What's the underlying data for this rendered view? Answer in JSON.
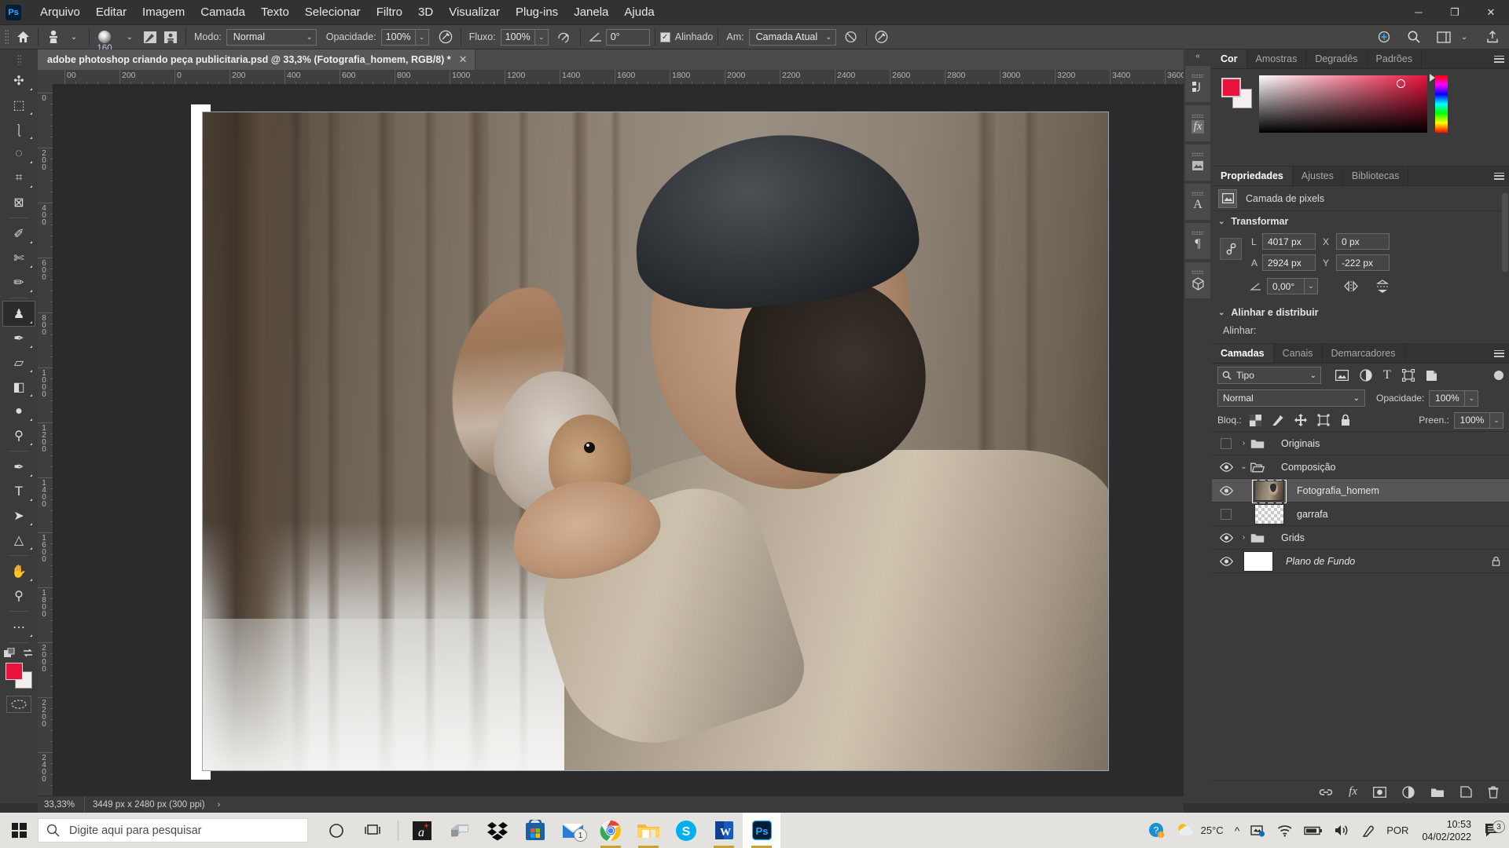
{
  "app": {
    "logo": "Ps",
    "menus": [
      "Arquivo",
      "Editar",
      "Imagem",
      "Camada",
      "Texto",
      "Selecionar",
      "Filtro",
      "3D",
      "Visualizar",
      "Plug-ins",
      "Janela",
      "Ajuda"
    ],
    "window_controls": {
      "minimize": "─",
      "maximize": "❐",
      "close": "✕"
    }
  },
  "options_bar": {
    "home_icon": "home-icon",
    "tool_preset_icon": "clone-stamp-icon",
    "brush_size": "160",
    "brush_panel_icon": "brush-settings-icon",
    "clone_source_icon": "clone-source-icon",
    "mode_label": "Modo:",
    "mode_value": "Normal",
    "opacity_label": "Opacidade:",
    "opacity_value": "100%",
    "pressure_opacity_icon": "pressure-opacity-icon",
    "flow_label": "Fluxo:",
    "flow_value": "100%",
    "airbrush_icon": "airbrush-icon",
    "angle_label_icon": "angle-icon",
    "angle_value": "0°",
    "aligned_label": "Alinhado",
    "aligned_checked": true,
    "sample_label": "Am:",
    "sample_value": "Camada Atual",
    "ignore_adjustment_icon": "ignore-adjustment-icon",
    "pressure_size_icon": "pressure-size-icon",
    "share_icon": "share-icon",
    "search_icon": "search-icon",
    "workspace_icon": "workspace-icon",
    "export_icon": "export-icon"
  },
  "document": {
    "tab_title": "adobe photoshop criando peça publicitaria.psd @ 33,3% (Fotografia_homem, RGB/8) *",
    "tab_close": "✕"
  },
  "toolbar": {
    "tools": [
      {
        "name": "move-tool",
        "glyph": "✣",
        "has_submenu": true,
        "active": false
      },
      {
        "name": "marquee-tool",
        "glyph": "⬚",
        "has_submenu": true,
        "active": false
      },
      {
        "name": "lasso-tool",
        "glyph": "⎱",
        "has_submenu": true,
        "active": false
      },
      {
        "name": "object-selection-tool",
        "glyph": "◌",
        "has_submenu": true,
        "active": false
      },
      {
        "name": "crop-tool",
        "glyph": "⌗",
        "has_submenu": true,
        "active": false
      },
      {
        "name": "frame-tool",
        "glyph": "⊠",
        "has_submenu": false,
        "active": false
      },
      {
        "name": "eyedropper-tool",
        "glyph": "✐",
        "has_submenu": true,
        "active": false
      },
      {
        "name": "spot-healing-brush-tool",
        "glyph": "✄",
        "has_submenu": true,
        "active": false
      },
      {
        "name": "brush-tool",
        "glyph": "✏",
        "has_submenu": true,
        "active": false
      },
      {
        "name": "clone-stamp-tool",
        "glyph": "♟",
        "has_submenu": true,
        "active": true
      },
      {
        "name": "history-brush-tool",
        "glyph": "✒",
        "has_submenu": true,
        "active": false
      },
      {
        "name": "eraser-tool",
        "glyph": "▱",
        "has_submenu": true,
        "active": false
      },
      {
        "name": "gradient-tool",
        "glyph": "◧",
        "has_submenu": true,
        "active": false
      },
      {
        "name": "blur-tool",
        "glyph": "●",
        "has_submenu": true,
        "active": false
      },
      {
        "name": "dodge-tool",
        "glyph": "⚲",
        "has_submenu": true,
        "active": false
      },
      {
        "name": "pen-tool",
        "glyph": "✒",
        "has_submenu": true,
        "active": false
      },
      {
        "name": "type-tool",
        "glyph": "T",
        "has_submenu": true,
        "active": false
      },
      {
        "name": "path-selection-tool",
        "glyph": "➤",
        "has_submenu": true,
        "active": false
      },
      {
        "name": "shape-tool",
        "glyph": "△",
        "has_submenu": true,
        "active": false
      },
      {
        "name": "hand-tool",
        "glyph": "✋",
        "has_submenu": true,
        "active": false
      },
      {
        "name": "zoom-tool",
        "glyph": "⚲",
        "has_submenu": false,
        "active": false
      },
      {
        "name": "edit-toolbar-tool",
        "glyph": "⋯",
        "has_submenu": true,
        "active": false
      }
    ],
    "foreground_color": "#e8123c",
    "background_color": "#f2ecec",
    "default-colors-icon": "default-colors-icon",
    "swap-colors-icon": "swap-colors-icon",
    "quick-mask-icon": "quick-mask-icon"
  },
  "canvas": {
    "ruler_h_labels": [
      "00",
      "200",
      "0",
      "200",
      "400",
      "600",
      "800",
      "1000",
      "1200",
      "1400",
      "1600",
      "1800",
      "2000",
      "2200",
      "2400",
      "2600",
      "2800",
      "3000",
      "3200",
      "3400",
      "3600"
    ],
    "ruler_v_labels": [
      "0",
      "200",
      "400",
      "600",
      "800",
      "1000",
      "1200",
      "1400",
      "1600",
      "1800",
      "2000",
      "2200",
      "2400"
    ],
    "image_alt": "man-feeding-squirrel-photo"
  },
  "status_bar": {
    "zoom": "33,33%",
    "doc_info": "3449 px x 2480 px (300 ppi)",
    "expander": "›"
  },
  "dock_strip": {
    "collapse_icon": "double-chevron-left-icon",
    "icons": [
      "history-icon",
      "fx-icon",
      "adjustments-icon",
      "character-icon",
      "paragraph-icon",
      "3d-icon"
    ]
  },
  "color_panel": {
    "tabs": [
      {
        "label": "Cor",
        "active": true
      },
      {
        "label": "Amostras",
        "active": false
      },
      {
        "label": "Degradês",
        "active": false
      },
      {
        "label": "Padrões",
        "active": false
      }
    ],
    "menu_icon": "panel-menu-icon",
    "foreground_color": "#e8123c",
    "background_color": "#f4eeee"
  },
  "properties_panel": {
    "tabs": [
      {
        "label": "Propriedades",
        "active": true
      },
      {
        "label": "Ajustes",
        "active": false
      },
      {
        "label": "Bibliotecas",
        "active": false
      }
    ],
    "menu_icon": "panel-menu-icon",
    "layer_kind_icon": "pixel-layer-icon",
    "layer_kind": "Camada de pixels",
    "transform": {
      "section_label": "Transformar",
      "w_label": "L",
      "w_value": "4017 px",
      "h_label": "A",
      "h_value": "2924 px",
      "x_label": "X",
      "x_value": "0 px",
      "y_label": "Y",
      "y_value": "-222 px",
      "angle_label_icon": "angle-icon",
      "angle_value": "0,00°",
      "flip_h_icon": "flip-horizontal-icon",
      "flip_v_icon": "flip-vertical-icon",
      "link_icon": "link-aspect-ratio-icon"
    },
    "align": {
      "section_label": "Alinhar e distribuir",
      "align_label": "Alinhar:"
    }
  },
  "layers_panel": {
    "tabs": [
      {
        "label": "Camadas",
        "active": true
      },
      {
        "label": "Canais",
        "active": false
      },
      {
        "label": "Demarcadores",
        "active": false
      }
    ],
    "menu_icon": "panel-menu-icon",
    "filter_label": "Tipo",
    "filter_icons": [
      "filter-pixel-icon",
      "filter-adjustment-icon",
      "filter-type-icon",
      "filter-shape-icon",
      "filter-smart-object-icon"
    ],
    "filter_toggle": "filter-enable-toggle",
    "blend_mode": "Normal",
    "opacity_label": "Opacidade:",
    "opacity_value": "100%",
    "lock_label": "Bloq.:",
    "lock_icons": [
      "lock-transparency-icon",
      "lock-image-icon",
      "lock-position-icon",
      "lock-artboard-icon",
      "lock-all-icon"
    ],
    "fill_label": "Preen.:",
    "fill_value": "100%",
    "layers": [
      {
        "name": "Originais",
        "type": "group",
        "visible": false,
        "expanded": false,
        "selected": false,
        "locked": false,
        "indent": 0,
        "thumb": "none"
      },
      {
        "name": "Composição",
        "type": "group",
        "visible": true,
        "expanded": true,
        "selected": false,
        "locked": false,
        "indent": 0,
        "thumb": "none"
      },
      {
        "name": "Fotografia_homem",
        "type": "pixel",
        "visible": true,
        "expanded": false,
        "selected": true,
        "locked": false,
        "indent": 1,
        "thumb": "photo"
      },
      {
        "name": "garrafa",
        "type": "pixel",
        "visible": false,
        "expanded": false,
        "selected": false,
        "locked": false,
        "indent": 1,
        "thumb": "transparent"
      },
      {
        "name": "Grids",
        "type": "group",
        "visible": true,
        "expanded": false,
        "selected": false,
        "locked": false,
        "indent": 0,
        "thumb": "none"
      },
      {
        "name": "Plano de Fundo",
        "type": "background",
        "visible": true,
        "expanded": false,
        "selected": false,
        "locked": true,
        "indent": 0,
        "thumb": "white"
      }
    ],
    "footer_icons": [
      "link-layers-icon",
      "fx-icon",
      "add-mask-icon",
      "new-adjustment-icon",
      "new-group-icon",
      "new-layer-icon",
      "delete-layer-icon"
    ]
  },
  "taskbar": {
    "start_icon": "windows-start-icon",
    "search_placeholder": "Digite aqui para pesquisar",
    "search_icon": "search-icon",
    "cortana_icon": "cortana-icon",
    "task_view_icon": "task-view-icon",
    "apps": [
      {
        "name": "affinity-app",
        "label": "a",
        "badge": null,
        "running": false,
        "active": false
      },
      {
        "name": "fax-scan-app",
        "label": "",
        "badge": null,
        "running": false,
        "active": false
      },
      {
        "name": "dropbox-app",
        "label": "",
        "badge": null,
        "running": false,
        "active": false
      },
      {
        "name": "microsoft-store-app",
        "label": "",
        "badge": null,
        "running": false,
        "active": false
      },
      {
        "name": "mail-app",
        "label": "",
        "badge": "1",
        "running": false,
        "active": false
      },
      {
        "name": "google-chrome-app",
        "label": "",
        "badge": null,
        "running": true,
        "active": false
      },
      {
        "name": "file-explorer-app",
        "label": "",
        "badge": null,
        "running": true,
        "active": false
      },
      {
        "name": "skype-app",
        "label": "S",
        "badge": null,
        "running": false,
        "active": false
      },
      {
        "name": "microsoft-word-app",
        "label": "W",
        "badge": null,
        "running": true,
        "active": false
      },
      {
        "name": "adobe-photoshop-app",
        "label": "Ps",
        "badge": null,
        "running": true,
        "active": true
      }
    ],
    "tray": {
      "help_icon": "help-question-icon",
      "weather_icon": "weather-partly-cloudy-icon",
      "temperature": "25°C",
      "overflow_icon": "show-hidden-icons-icon",
      "onedrive_icon": "onedrive-icon",
      "network_icon": "wifi-icon",
      "battery_icon": "battery-icon",
      "volume_icon": "volume-icon",
      "pen_icon": "windows-ink-icon",
      "language": "POR",
      "time": "10:53",
      "date": "04/02/2022",
      "notifications_icon": "action-center-icon",
      "notifications_count": "3"
    }
  }
}
